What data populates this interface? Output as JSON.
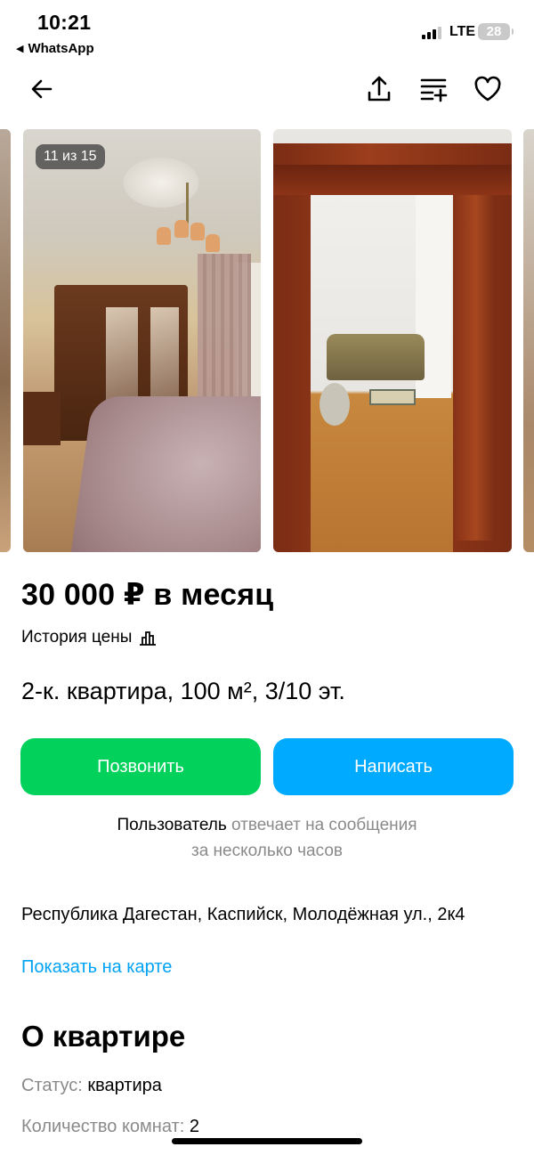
{
  "status_bar": {
    "time": "10:21",
    "back_app": "WhatsApp",
    "network": "LTE",
    "battery": "28"
  },
  "nav": {
    "back_icon": "arrow-left-icon",
    "share_icon": "share-icon",
    "compare_icon": "compare-list-icon",
    "favorite_icon": "heart-icon"
  },
  "gallery": {
    "counter": "11 из 15"
  },
  "listing": {
    "price": "30 000 ₽ в месяц",
    "price_history": "История цены",
    "title": "2-к. квартира, 100 м², 3/10 эт."
  },
  "actions": {
    "call_label": "Позвонить",
    "write_label": "Написать",
    "call_color": "#02d15c",
    "write_color": "#00aaff"
  },
  "seller": {
    "user": "Пользователь",
    "reply_line1": "отвечает на сообщения",
    "reply_line2": "за несколько часов"
  },
  "location": {
    "address": "Республика Дагестан, Каспийск, Молодёжная ул., 2к4",
    "map_link": "Показать на карте",
    "link_color": "#00a3f5"
  },
  "about": {
    "title": "О квартире",
    "params": [
      {
        "label": "Статус:",
        "value": "квартира"
      },
      {
        "label": "Количество комнат:",
        "value": "2"
      }
    ]
  }
}
